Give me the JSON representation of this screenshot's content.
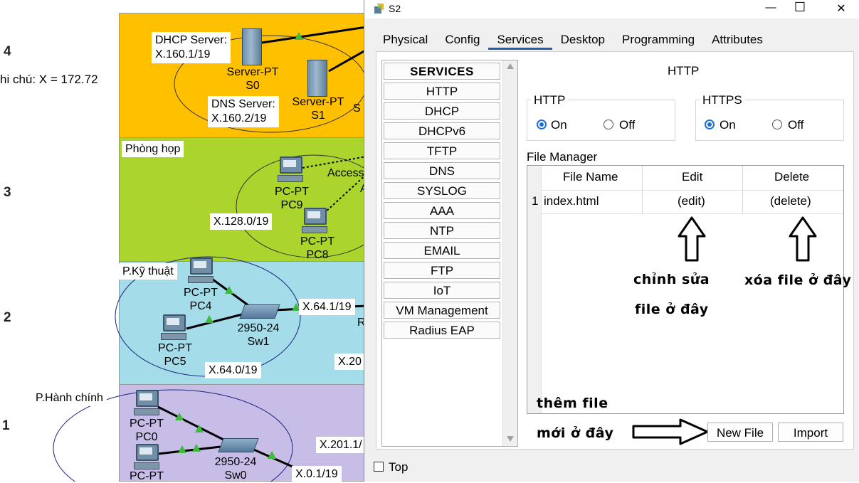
{
  "topology": {
    "floors": [
      "4",
      "3",
      "2",
      "1"
    ],
    "note_left": "hi chú: X = 172.72",
    "zones": [
      {
        "color": "#ffc000"
      },
      {
        "color": "#abd42d"
      },
      {
        "color": "#a4dcea"
      },
      {
        "color": "#c8bde6"
      }
    ],
    "labels": {
      "dhcp_server": "DHCP Server:",
      "dhcp_addr": "X.160.1/19",
      "dns_server": "DNS Server:",
      "dns_addr": "X.160.2/19",
      "server0_type": "Server-PT",
      "server0_name": "S0",
      "server1_type": "Server-PT",
      "server1_name": "S1",
      "server2_partial": "S",
      "room_meeting": "Phòng họp",
      "access_partial": "Access",
      "access_partial2": "A",
      "pc9_type": "PC-PT",
      "pc9_name": "PC9",
      "net_128": "X.128.0/19",
      "pc8_type": "PC-PT",
      "pc8_name": "PC8",
      "room_tech": "P.Kỹ thuật",
      "pc4_type": "PC-PT",
      "pc4_name": "PC4",
      "sw1_type": "2950-24",
      "sw1_name": "Sw1",
      "gw_64": "X.64.1/19",
      "router_partial": "R",
      "pc5_type": "PC-PT",
      "pc5_name": "PC5",
      "net_64": "X.64.0/19",
      "net_20_partial": "X.20",
      "room_admin": "P.Hành chính",
      "pc0_type": "PC-PT",
      "pc0_name": "PC0",
      "sw0_type": "2950-24",
      "sw0_name": "Sw0",
      "pc_partial_type": "PC-PT",
      "net_201_partial": "X.201.1/",
      "gw_0": "X.0.1/19"
    }
  },
  "window": {
    "title": "S2",
    "controls": {
      "minimize": "—",
      "maximize": "☐",
      "close": "✕"
    },
    "tabs": [
      "Physical",
      "Config",
      "Services",
      "Desktop",
      "Programming",
      "Attributes"
    ],
    "active_tab": "Services",
    "services_header": "SERVICES",
    "services": [
      "HTTP",
      "DHCP",
      "DHCPv6",
      "TFTP",
      "DNS",
      "SYSLOG",
      "AAA",
      "NTP",
      "EMAIL",
      "FTP",
      "IoT",
      "VM Management",
      "Radius EAP"
    ],
    "section_title": "HTTP",
    "http_group": {
      "label": "HTTP",
      "on": "On",
      "off": "Off",
      "selected": "On"
    },
    "https_group": {
      "label": "HTTPS",
      "on": "On",
      "off": "Off",
      "selected": "On"
    },
    "file_manager": {
      "label": "File Manager",
      "columns": [
        "File Name",
        "Edit",
        "Delete"
      ],
      "rows": [
        {
          "index": "1",
          "name": "index.html",
          "edit": "(edit)",
          "delete": "(delete)"
        }
      ]
    },
    "buttons": {
      "new_file": "New File",
      "import": "Import"
    },
    "top_checkbox": "Top",
    "annotations": {
      "edit_line1": "chỉnh sửa",
      "edit_line2": "file ở đây",
      "delete_note": "xóa file ở đây",
      "new_line1": "thêm file",
      "new_line2": "mới ở đây"
    }
  }
}
